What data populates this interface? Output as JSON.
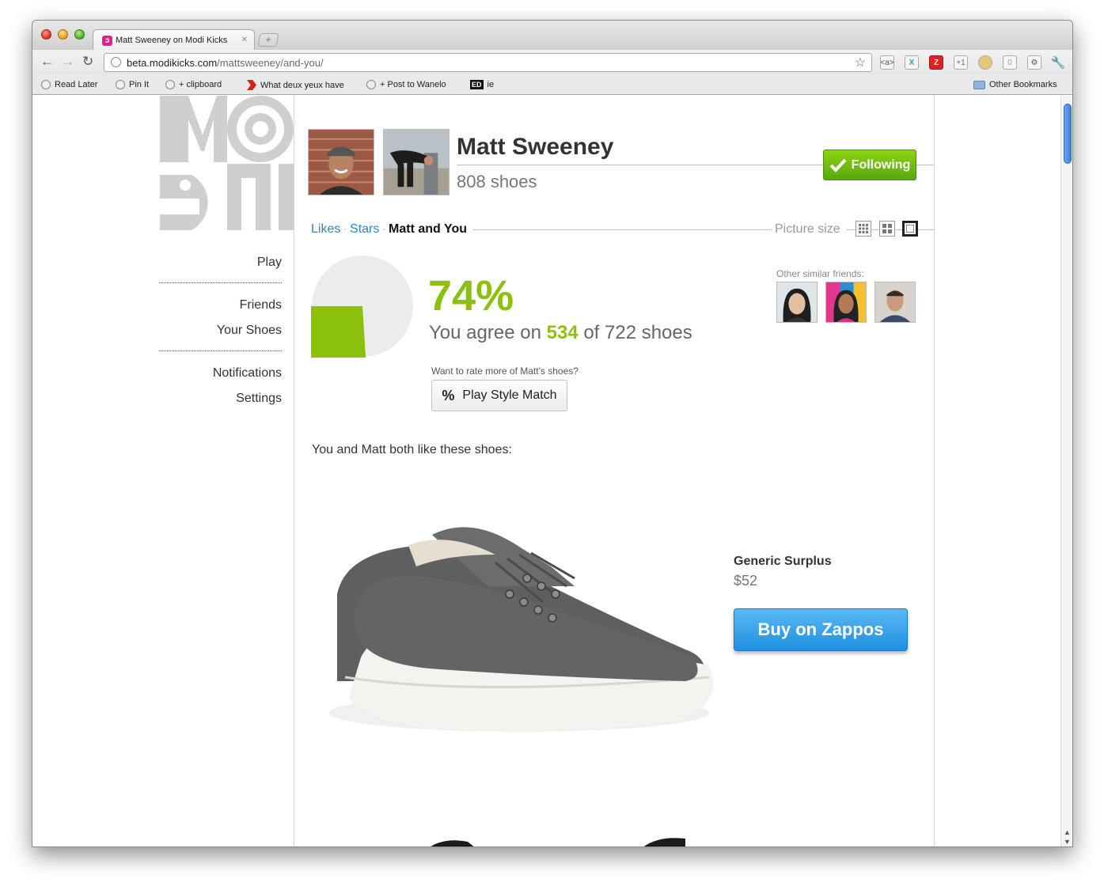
{
  "browser": {
    "tab_title": "Matt Sweeney on Modi Kicks",
    "tab_favicon": "modi-favicon",
    "url_host": "beta.modikicks.com",
    "url_path": "/mattsweeney/and-you/",
    "extensions": [
      "<a>",
      "X",
      "Z",
      "+1",
      "cookie",
      "0",
      "page",
      "wrench"
    ],
    "bookmarks": [
      {
        "label": "Read Later",
        "icon": "globe-icon"
      },
      {
        "label": "Pin It",
        "icon": "globe-icon"
      },
      {
        "label": "+ clipboard",
        "icon": "globe-icon"
      },
      {
        "label": "What deux yeux have",
        "icon": "arrow-icon"
      },
      {
        "label": "+ Post to Wanelo",
        "icon": "globe-icon"
      },
      {
        "label": "ie",
        "icon": "ed-icon"
      },
      {
        "label": "Other Bookmarks",
        "icon": "folder-icon"
      }
    ]
  },
  "site": {
    "logo_text": "MODI",
    "nav": {
      "play": "Play",
      "friends": "Friends",
      "your_shoes": "Your Shoes",
      "notifications": "Notifications",
      "settings": "Settings"
    }
  },
  "profile": {
    "name": "Matt Sweeney",
    "shoe_count": "808 shoes",
    "follow_label": "Following",
    "tabs": {
      "likes": "Likes",
      "stars": "Stars",
      "current": "Matt and You"
    },
    "picture_size_label": "Picture size"
  },
  "match": {
    "percent": "74%",
    "percent_value": 0.74,
    "agree_prefix": "You agree on",
    "agree_count": "534",
    "agree_suffix": "of 722 shoes",
    "rate_more": "Want to rate more of Matt's shoes?",
    "play_button": "Play Style Match",
    "similar_label": "Other similar friends:",
    "colors": {
      "accent": "#8bc10b",
      "pie_rest": "#ececec"
    }
  },
  "shoes": {
    "heading": "You and Matt both like these shoes:",
    "items": [
      {
        "brand": "Generic Surplus",
        "price": "$52",
        "buy_label": "Buy on Zappos"
      }
    ]
  }
}
